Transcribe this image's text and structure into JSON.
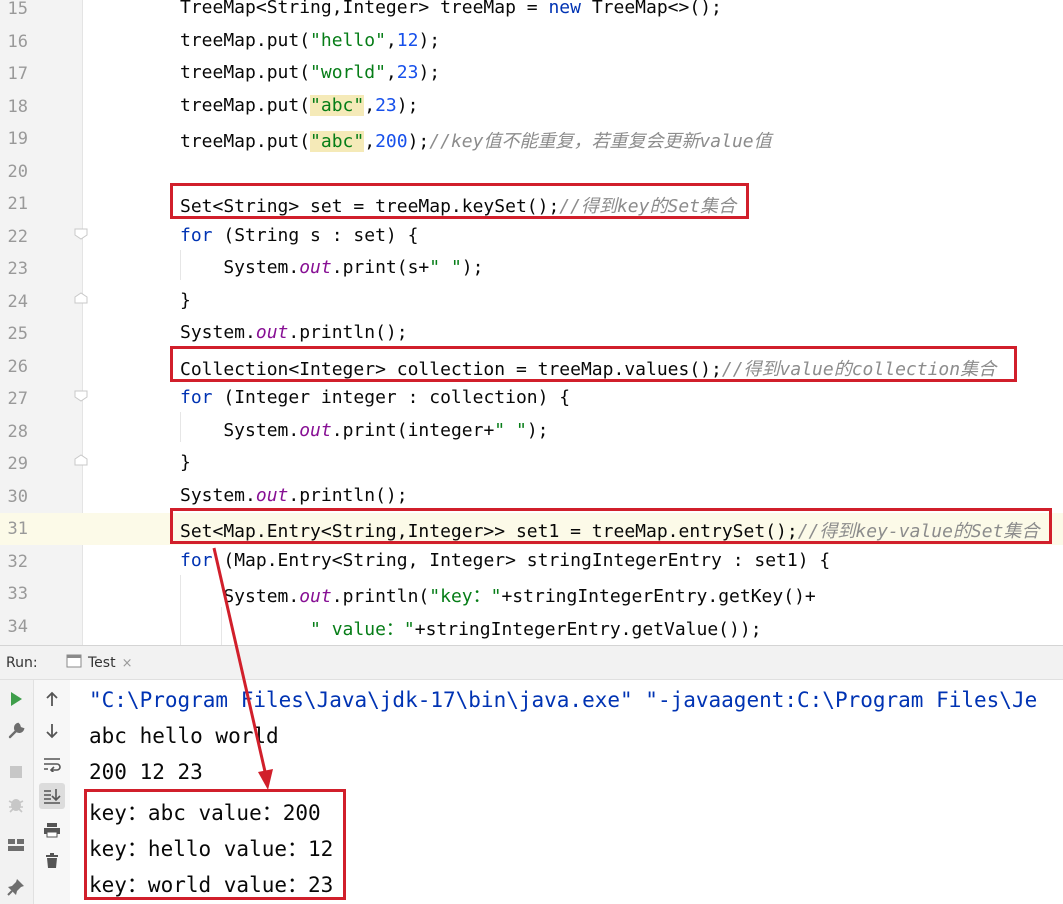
{
  "editor": {
    "lines": [
      {
        "num": "15",
        "segments": [
          {
            "t": "TreeMap<String,Integer> treeMap = "
          },
          {
            "t": "new",
            "c": "kw"
          },
          {
            "t": " TreeMap<>();"
          }
        ]
      },
      {
        "num": "16",
        "segments": [
          {
            "t": "treeMap.put("
          },
          {
            "t": "\"hello\"",
            "c": "str"
          },
          {
            "t": ","
          },
          {
            "t": "12",
            "c": "num"
          },
          {
            "t": ");"
          }
        ]
      },
      {
        "num": "17",
        "segments": [
          {
            "t": "treeMap.put("
          },
          {
            "t": "\"world\"",
            "c": "str"
          },
          {
            "t": ","
          },
          {
            "t": "23",
            "c": "num"
          },
          {
            "t": ");"
          }
        ]
      },
      {
        "num": "18",
        "segments": [
          {
            "t": "treeMap.put("
          },
          {
            "t": "\"abc\"",
            "c": "str hl"
          },
          {
            "t": ","
          },
          {
            "t": "23",
            "c": "num"
          },
          {
            "t": ");"
          }
        ]
      },
      {
        "num": "19",
        "segments": [
          {
            "t": "treeMap.put("
          },
          {
            "t": "\"abc\"",
            "c": "str hl"
          },
          {
            "t": ","
          },
          {
            "t": "200",
            "c": "num"
          },
          {
            "t": ");"
          },
          {
            "t": "//key值不能重复，若重复会更新value值",
            "c": "cmt"
          }
        ]
      },
      {
        "num": "20",
        "segments": []
      },
      {
        "num": "21",
        "segments": [
          {
            "t": "Set<String> set = treeMap.keySet();"
          },
          {
            "t": "//得到key的Set集合",
            "c": "cmt"
          }
        ]
      },
      {
        "num": "22",
        "segments": [
          {
            "t": "for",
            "c": "kw"
          },
          {
            "t": " (String s : set) {"
          }
        ]
      },
      {
        "num": "23",
        "segments": [
          {
            "t": "    System."
          },
          {
            "t": "out",
            "c": "fld"
          },
          {
            "t": ".print(s+"
          },
          {
            "t": "\" \"",
            "c": "str"
          },
          {
            "t": ");"
          }
        ]
      },
      {
        "num": "24",
        "segments": [
          {
            "t": "}"
          }
        ]
      },
      {
        "num": "25",
        "segments": [
          {
            "t": "System."
          },
          {
            "t": "out",
            "c": "fld"
          },
          {
            "t": ".println();"
          }
        ]
      },
      {
        "num": "26",
        "segments": [
          {
            "t": "Collection<Integer> collection = treeMap.values();"
          },
          {
            "t": "//得到value的collection集合",
            "c": "cmt"
          }
        ]
      },
      {
        "num": "27",
        "segments": [
          {
            "t": "for",
            "c": "kw"
          },
          {
            "t": " (Integer integer : collection) {"
          }
        ]
      },
      {
        "num": "28",
        "segments": [
          {
            "t": "    System."
          },
          {
            "t": "out",
            "c": "fld"
          },
          {
            "t": ".print(integer+"
          },
          {
            "t": "\" \"",
            "c": "str"
          },
          {
            "t": ");"
          }
        ]
      },
      {
        "num": "29",
        "segments": [
          {
            "t": "}"
          }
        ]
      },
      {
        "num": "30",
        "segments": [
          {
            "t": "System."
          },
          {
            "t": "out",
            "c": "fld"
          },
          {
            "t": ".println();"
          }
        ]
      },
      {
        "num": "31",
        "segments": [
          {
            "t": "Set<Map.Entry<String,Integer>> set1 = treeMap.entrySet();"
          },
          {
            "t": "//得到key-value的Set集合",
            "c": "cmt"
          }
        ]
      },
      {
        "num": "32",
        "segments": [
          {
            "t": "for",
            "c": "kw"
          },
          {
            "t": " (Map.Entry<String, Integer> stringIntegerEntry : set1) {"
          }
        ]
      },
      {
        "num": "33",
        "segments": [
          {
            "t": "    System."
          },
          {
            "t": "out",
            "c": "fld"
          },
          {
            "t": ".println("
          },
          {
            "t": "\"key：\"",
            "c": "str"
          },
          {
            "t": "+stringIntegerEntry.getKey()+"
          }
        ]
      },
      {
        "num": "34",
        "segments": [
          {
            "t": "            "
          },
          {
            "t": "\" value：\"",
            "c": "str"
          },
          {
            "t": "+stringIntegerEntry.getValue());"
          }
        ]
      }
    ]
  },
  "run_panel": {
    "label": "Run:",
    "tab_label": "Test",
    "tab_close": "×"
  },
  "console": {
    "lines": [
      "\"C:\\Program Files\\Java\\jdk-17\\bin\\java.exe\" \"-javaagent:C:\\Program Files\\Je",
      "abc hello world",
      "200 12 23",
      "key：abc value：200",
      "key：hello value：12",
      "key：world value：23"
    ]
  },
  "colors": {
    "annotation_red": "#d11f2b",
    "keyword": "#0033b3",
    "string": "#067d17",
    "number": "#1750eb",
    "comment": "#8c8c8c"
  }
}
